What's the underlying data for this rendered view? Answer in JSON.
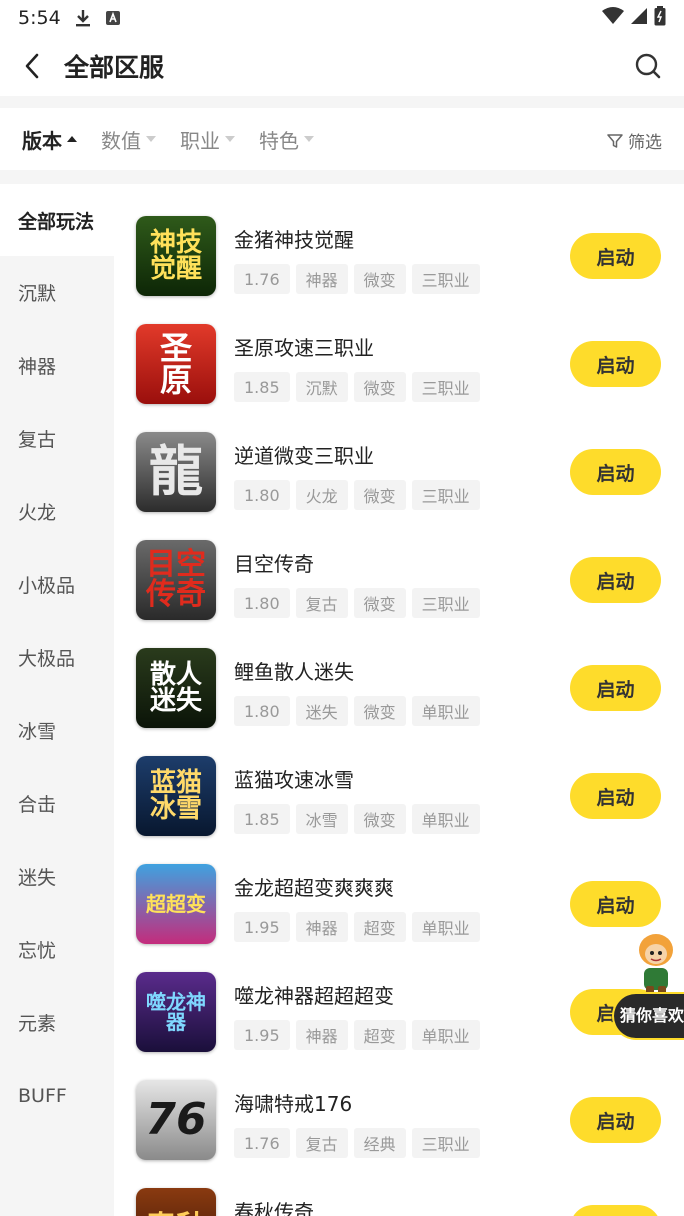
{
  "status": {
    "time": "5:54"
  },
  "header": {
    "title": "全部区服"
  },
  "filters": {
    "tabs": [
      {
        "label": "版本"
      },
      {
        "label": "数值"
      },
      {
        "label": "职业"
      },
      {
        "label": "特色"
      }
    ],
    "screen_label": "筛选"
  },
  "sidebar": {
    "items": [
      {
        "label": "全部玩法"
      },
      {
        "label": "沉默"
      },
      {
        "label": "神器"
      },
      {
        "label": "复古"
      },
      {
        "label": "火龙"
      },
      {
        "label": "小极品"
      },
      {
        "label": "大极品"
      },
      {
        "label": "冰雪"
      },
      {
        "label": "合击"
      },
      {
        "label": "迷失"
      },
      {
        "label": "忘忧"
      },
      {
        "label": "元素"
      },
      {
        "label": "BUFF"
      }
    ]
  },
  "games": [
    {
      "name": "金猪神技觉醒",
      "icon_text": "神技觉醒",
      "tags": [
        "1.76",
        "神器",
        "微变",
        "三职业"
      ],
      "button": "启动"
    },
    {
      "name": "圣原攻速三职业",
      "icon_text": "圣原",
      "tags": [
        "1.85",
        "沉默",
        "微变",
        "三职业"
      ],
      "button": "启动"
    },
    {
      "name": "逆道微变三职业",
      "icon_text": "龍",
      "tags": [
        "1.80",
        "火龙",
        "微变",
        "三职业"
      ],
      "button": "启动"
    },
    {
      "name": "目空传奇",
      "icon_text": "目空传奇",
      "tags": [
        "1.80",
        "复古",
        "微变",
        "三职业"
      ],
      "button": "启动"
    },
    {
      "name": "鲤鱼散人迷失",
      "icon_text": "散人迷失",
      "tags": [
        "1.80",
        "迷失",
        "微变",
        "单职业"
      ],
      "button": "启动"
    },
    {
      "name": "蓝猫攻速冰雪",
      "icon_text": "蓝猫冰雪",
      "tags": [
        "1.85",
        "冰雪",
        "微变",
        "单职业"
      ],
      "button": "启动"
    },
    {
      "name": "金龙超超变爽爽爽",
      "icon_text": "超超变",
      "tags": [
        "1.95",
        "神器",
        "超变",
        "单职业"
      ],
      "button": "启动"
    },
    {
      "name": "噬龙神器超超超变",
      "icon_text": "噬龙神器",
      "tags": [
        "1.95",
        "神器",
        "超变",
        "单职业"
      ],
      "button": "启动"
    },
    {
      "name": "海啸特戒176",
      "icon_text": "76",
      "tags": [
        "1.76",
        "复古",
        "经典",
        "三职业"
      ],
      "button": "启动"
    },
    {
      "name": "春秋传奇",
      "icon_text": "春秋",
      "tags": [],
      "button": "启动"
    }
  ],
  "floating": {
    "label": "猜你喜欢"
  },
  "colors": {
    "accent": "#fedc2b",
    "tag_bg": "#f3f3f3",
    "page_bg": "#f5f5f5"
  }
}
